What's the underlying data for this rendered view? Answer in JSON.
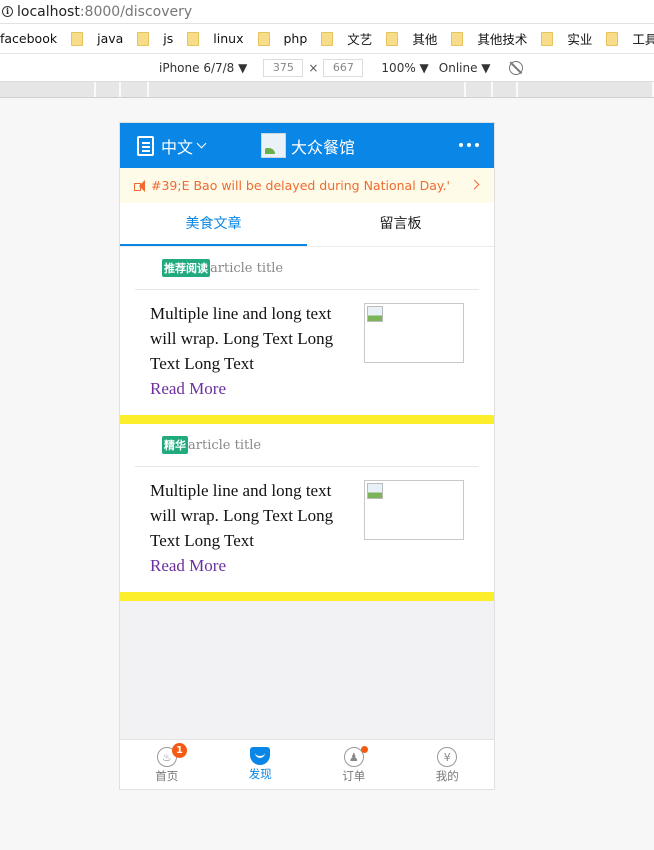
{
  "browser": {
    "url_host": "localhost",
    "url_path": ":8000/discovery",
    "bookmarks": [
      "facebook",
      "java",
      "js",
      "linux",
      "php",
      "文艺",
      "其他",
      "其他技术",
      "实业",
      "工具"
    ],
    "device": "iPhone 6/7/8 ▼",
    "width": "375",
    "times": "×",
    "height": "667",
    "zoom": "100% ▼",
    "network": "Online ▼"
  },
  "header": {
    "language": "中文",
    "title": "大众餐馆"
  },
  "notice": {
    "text": "#39;E Bao will be delayed during National Day.'"
  },
  "tabs": [
    {
      "label": "美食文章",
      "active": true
    },
    {
      "label": "留言板",
      "active": false
    }
  ],
  "articles": [
    {
      "tag": "推荐阅读",
      "title": "article title",
      "body": "Multiple line and long text will wrap. Long Text Long Text Long Text",
      "read_more": "Read More"
    },
    {
      "tag": "精华",
      "title": "article title",
      "body": "Multiple line and long text will wrap. Long Text Long Text Long Text",
      "read_more": "Read More"
    }
  ],
  "tabbar": [
    {
      "label": "首页",
      "icon": "home-icon",
      "badge": "1"
    },
    {
      "label": "发现",
      "icon": "discover-icon",
      "active": true
    },
    {
      "label": "订单",
      "icon": "orders-icon",
      "dot": true
    },
    {
      "label": "我的",
      "icon": "yen-icon",
      "glyph": "¥"
    }
  ],
  "colors": {
    "primary": "#0a86e6",
    "notice": "#ee6a2f",
    "tag": "#22aa7f",
    "divider": "#fcee2a",
    "badge": "#f45a11"
  }
}
